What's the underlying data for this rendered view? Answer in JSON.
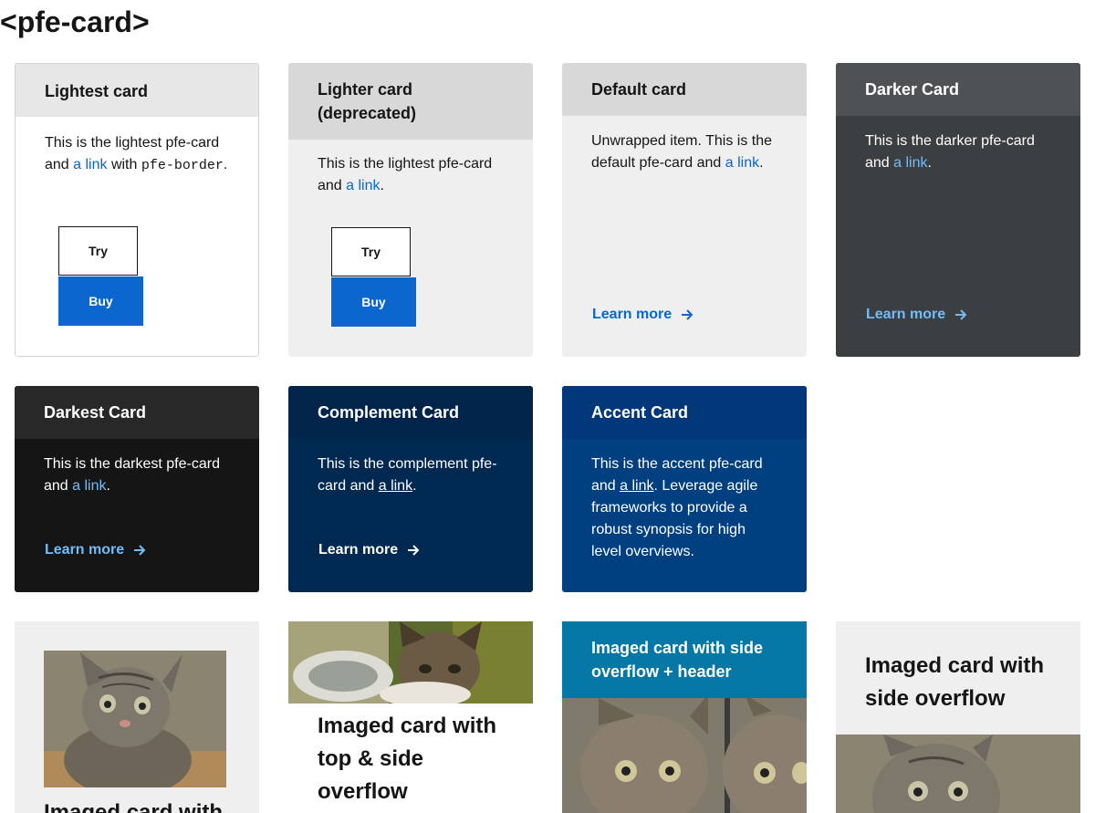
{
  "page": {
    "title": "<pfe-card>"
  },
  "colors": {
    "link_blue": "#0b66ce",
    "link_light": "#73bcf7",
    "button_blue": "#0b66ce"
  },
  "cards": {
    "lightest": {
      "header": "Lightest card",
      "body_pre": "This is the lightest pfe-card and ",
      "link": "a link",
      "body_mid": " with ",
      "code": "pfe-border",
      "body_post": ".",
      "try_label": "Try",
      "buy_label": "Buy"
    },
    "lighter": {
      "header": "Lighter card (deprecated)",
      "body_pre": "This is the lightest pfe-card and ",
      "link": "a link",
      "body_post": ".",
      "try_label": "Try",
      "buy_label": "Buy"
    },
    "default": {
      "header": "Default card",
      "body_pre": "Unwrapped item. This is the default pfe-card and ",
      "link": "a link",
      "body_post": ".",
      "cta": "Learn more"
    },
    "darker": {
      "header": "Darker Card",
      "body_pre": "This is the darker pfe-card and ",
      "link": "a link",
      "body_post": ".",
      "cta": "Learn more"
    },
    "darkest": {
      "header": "Darkest Card",
      "body_pre": "This is the darkest pfe-card and ",
      "link": "a link",
      "body_post": ".",
      "cta": "Learn more"
    },
    "complement": {
      "header": "Complement Card",
      "body_pre": "This is the complement pfe-card and ",
      "link": "a link",
      "body_post": ".",
      "cta": "Learn more"
    },
    "accent": {
      "header": "Accent Card",
      "body_pre": "This is the accent pfe-card and ",
      "link": "a link",
      "body_post": ". Leverage agile frameworks to provide a robust synopsis for high level overviews."
    },
    "imaged1": {
      "title": "Imaged card with"
    },
    "imaged2": {
      "title": "Imaged card with top & side overflow"
    },
    "imaged3": {
      "header": "Imaged card with side overflow + header"
    },
    "imaged4": {
      "title": "Imaged card with side overflow"
    }
  }
}
